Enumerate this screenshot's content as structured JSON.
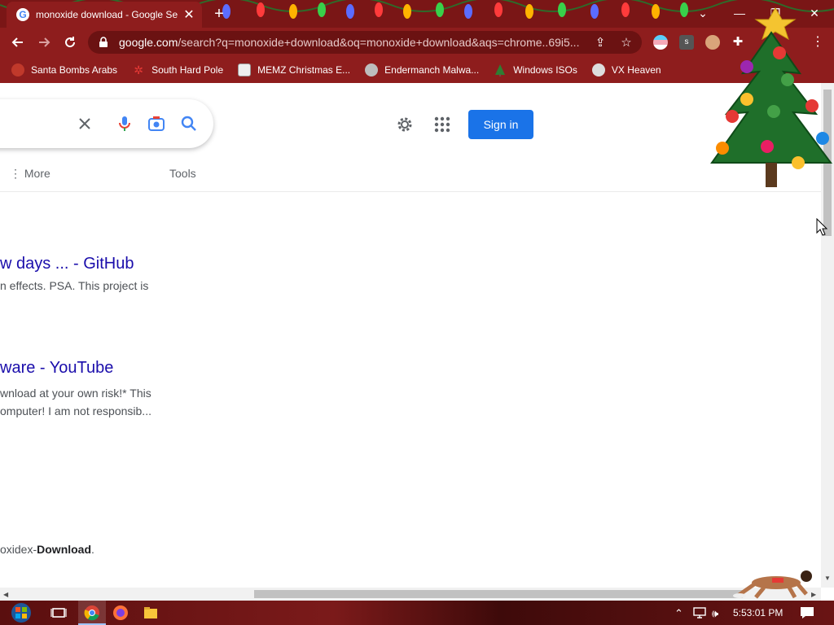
{
  "tab": {
    "title": "monoxide download - Google Se",
    "close": "✕"
  },
  "window_controls": {
    "minimize": "—",
    "maximize": "❐",
    "close": "✕",
    "dropdown": "⌄"
  },
  "new_tab": "+",
  "omnibox": {
    "url_domain": "google.com",
    "url_rest": "/search?q=monoxide+download&oq=monoxide+download&aqs=chrome..69i5..."
  },
  "bookmarks": [
    {
      "label": "Santa Bombs Arabs",
      "icon": "santa-icon",
      "color": "#c0392b"
    },
    {
      "label": "South Hard Pole",
      "icon": "snowflake-icon",
      "color": "#e53935"
    },
    {
      "label": "MEMZ Christmas E...",
      "icon": "memz-icon",
      "color": "#eeeeee"
    },
    {
      "label": "Endermanch Malwa...",
      "icon": "raccoon-icon",
      "color": "#cfcfcf"
    },
    {
      "label": "Windows ISOs",
      "icon": "tree-icon",
      "color": "#2e7d32"
    },
    {
      "label": "VX Heaven",
      "icon": "vx-icon",
      "color": "#dddddd"
    }
  ],
  "page": {
    "sign_in": "Sign in",
    "nav_more": "⋮ More",
    "nav_tools": "Tools",
    "results": [
      {
        "title": "w days ... - GitHub",
        "snippet": [
          "n effects. PSA. This project is"
        ]
      },
      {
        "title": "ware - YouTube",
        "snippet": [
          "wnload at your own risk!* This",
          "omputer! I am not responsib..."
        ]
      }
    ],
    "third_snippet_prefix": "oxidex-",
    "third_snippet_bold": "Download",
    "third_snippet_suffix": "."
  },
  "taskbar": {
    "time": "5:53:01 PM"
  },
  "colors": {
    "chrome_red": "#8e1d1d",
    "link": "#1a0dab",
    "signin_blue": "#1a73e8"
  }
}
